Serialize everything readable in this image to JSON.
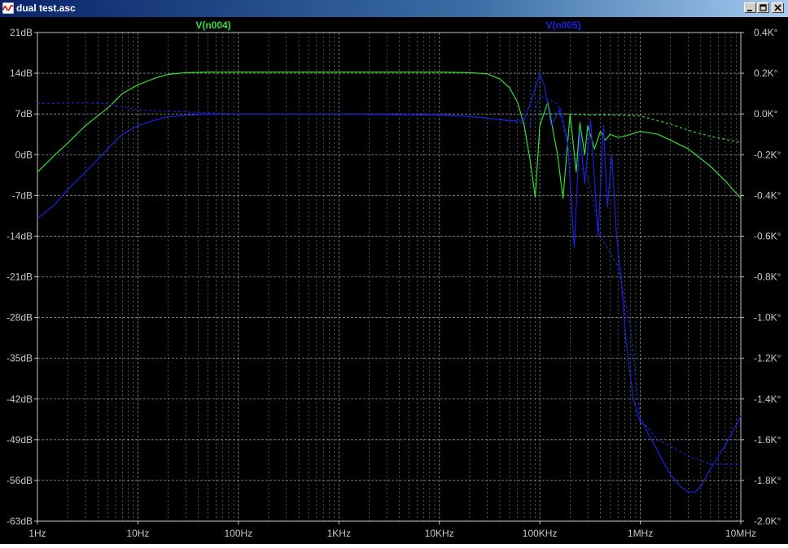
{
  "window": {
    "title": "dual test.asc",
    "controls": [
      "minimize-icon",
      "restore-icon",
      "close-icon"
    ]
  },
  "colors": {
    "background": "#000000",
    "grid": "#8c8c8c",
    "axis_text": "#c8c8c8",
    "series_green": "#33dd33",
    "series_blue": "#1a22dd"
  },
  "chart_data": {
    "type": "line",
    "title": "",
    "x_scale": "log",
    "xlim": [
      1,
      10000000
    ],
    "x_ticks": [
      {
        "v": 1,
        "label": "1Hz"
      },
      {
        "v": 10,
        "label": "10Hz"
      },
      {
        "v": 100,
        "label": "100Hz"
      },
      {
        "v": 1000,
        "label": "1KHz"
      },
      {
        "v": 10000,
        "label": "10KHz"
      },
      {
        "v": 100000,
        "label": "100KHz"
      },
      {
        "v": 1000000,
        "label": "1MHz"
      },
      {
        "v": 10000000,
        "label": "10MHz"
      }
    ],
    "y_left": {
      "unit": "dB",
      "ylim": [
        -63,
        21
      ],
      "ticks": [
        {
          "v": 21,
          "label": "21dB"
        },
        {
          "v": 14,
          "label": "14dB"
        },
        {
          "v": 7,
          "label": "7dB"
        },
        {
          "v": 0,
          "label": "0dB"
        },
        {
          "v": -7,
          "label": "-7dB"
        },
        {
          "v": -14,
          "label": "-14dB"
        },
        {
          "v": -21,
          "label": "-21dB"
        },
        {
          "v": -28,
          "label": "-28dB"
        },
        {
          "v": -35,
          "label": "-35dB"
        },
        {
          "v": -42,
          "label": "-42dB"
        },
        {
          "v": -49,
          "label": "-49dB"
        },
        {
          "v": -56,
          "label": "-56dB"
        },
        {
          "v": -63,
          "label": "-63dB"
        }
      ]
    },
    "y_right": {
      "unit": "°",
      "ylim": [
        -2000,
        400
      ],
      "ticks": [
        {
          "v": 400,
          "label": "0.4K°"
        },
        {
          "v": 200,
          "label": "0.2K°"
        },
        {
          "v": 0,
          "label": "0.0K°"
        },
        {
          "v": -200,
          "label": "-0.2K°"
        },
        {
          "v": -400,
          "label": "-0.4K°"
        },
        {
          "v": -600,
          "label": "-0.6K°"
        },
        {
          "v": -800,
          "label": "-0.8K°"
        },
        {
          "v": -1000,
          "label": "-1.0K°"
        },
        {
          "v": -1200,
          "label": "-1.2K°"
        },
        {
          "v": -1400,
          "label": "-1.4K°"
        },
        {
          "v": -1600,
          "label": "-1.6K°"
        },
        {
          "v": -1800,
          "label": "-1.8K°"
        },
        {
          "v": -2000,
          "label": "-2.0K°"
        }
      ]
    },
    "grid": true,
    "legend": [
      "V(n004)",
      "V(n005)"
    ],
    "series": [
      {
        "name": "V(n004)",
        "color": "#33dd33",
        "kind": "magnitude",
        "x": [
          1,
          1.5,
          2,
          3,
          5,
          7,
          10,
          15,
          20,
          30,
          50,
          100,
          300,
          1000,
          3000,
          10000,
          20000,
          30000,
          40000,
          50000,
          60000,
          70000,
          80000,
          90000,
          100000,
          120000,
          150000,
          170000,
          200000,
          230000,
          250000,
          280000,
          300000,
          350000,
          400000,
          450000,
          500000,
          600000,
          700000,
          800000,
          1000000,
          1500000,
          2000000,
          3000000,
          5000000,
          7000000,
          10000000
        ],
        "y": [
          -3,
          0,
          2,
          5,
          8,
          10.5,
          12,
          13.2,
          13.8,
          14.1,
          14.2,
          14.2,
          14.2,
          14.2,
          14.2,
          14.2,
          14.1,
          13.9,
          13,
          11.5,
          9,
          5,
          -1,
          -7.3,
          5,
          9,
          0,
          -7.5,
          7,
          -3,
          5.5,
          0,
          5,
          1,
          4,
          2.5,
          3.5,
          3,
          3.2,
          3.5,
          4,
          3.5,
          2.5,
          1,
          -2,
          -4.5,
          -7.5
        ]
      },
      {
        "name": "V(n004) phase",
        "color": "#33dd33",
        "kind": "phase",
        "style": "dashed",
        "x": [
          100000,
          200000,
          300000,
          500000,
          1000000,
          2000000,
          3000000,
          5000000,
          10000000
        ],
        "y": [
          0,
          0,
          -5,
          -5,
          -10,
          -50,
          -80,
          -110,
          -140
        ]
      },
      {
        "name": "V(n005)",
        "color": "#1a22dd",
        "kind": "magnitude",
        "x": [
          1,
          1.5,
          2,
          3,
          5,
          7,
          10,
          15,
          20,
          30,
          50,
          100,
          300,
          1000,
          3000,
          10000,
          20000,
          30000,
          50000,
          70000,
          85000,
          100000,
          110000,
          130000,
          160000,
          190000,
          220000,
          250000,
          280000,
          320000,
          380000,
          430000,
          470000,
          520000,
          580000,
          650000,
          720000,
          850000,
          1000000,
          1100000,
          1200000,
          1400000,
          1600000,
          2000000,
          2500000,
          3000000,
          3500000,
          4000000,
          5000000,
          7000000,
          10000000
        ],
        "y": [
          -11,
          -8.5,
          -6,
          -3,
          1,
          3.5,
          5,
          6,
          6.5,
          6.8,
          7,
          7,
          7,
          7,
          6.9,
          6.8,
          6.6,
          6.3,
          5.8,
          6,
          10,
          14,
          12,
          5,
          8,
          2,
          -16,
          4,
          -5,
          6,
          -14,
          5,
          -9,
          0,
          -14,
          -22,
          -32,
          -42,
          -46,
          -46.5,
          -48,
          -50,
          -52,
          -55,
          -57,
          -58,
          -58,
          -57,
          -54,
          -50,
          -45
        ]
      },
      {
        "name": "V(n005) phase",
        "color": "#1a22dd",
        "kind": "phase",
        "style": "dashed",
        "x": [
          1,
          3,
          5,
          10,
          30,
          100,
          1000,
          10000,
          50000,
          80000,
          100000,
          150000,
          200000,
          300000,
          400000,
          600000,
          800000,
          1000000,
          1500000,
          3000000,
          5000000,
          10000000
        ],
        "y": [
          50,
          55,
          50,
          20,
          10,
          0,
          0,
          0,
          -30,
          -55,
          90,
          50,
          -200,
          -300,
          -600,
          -750,
          -1050,
          -1500,
          -1600,
          -1680,
          -1720,
          -1720
        ]
      }
    ]
  }
}
